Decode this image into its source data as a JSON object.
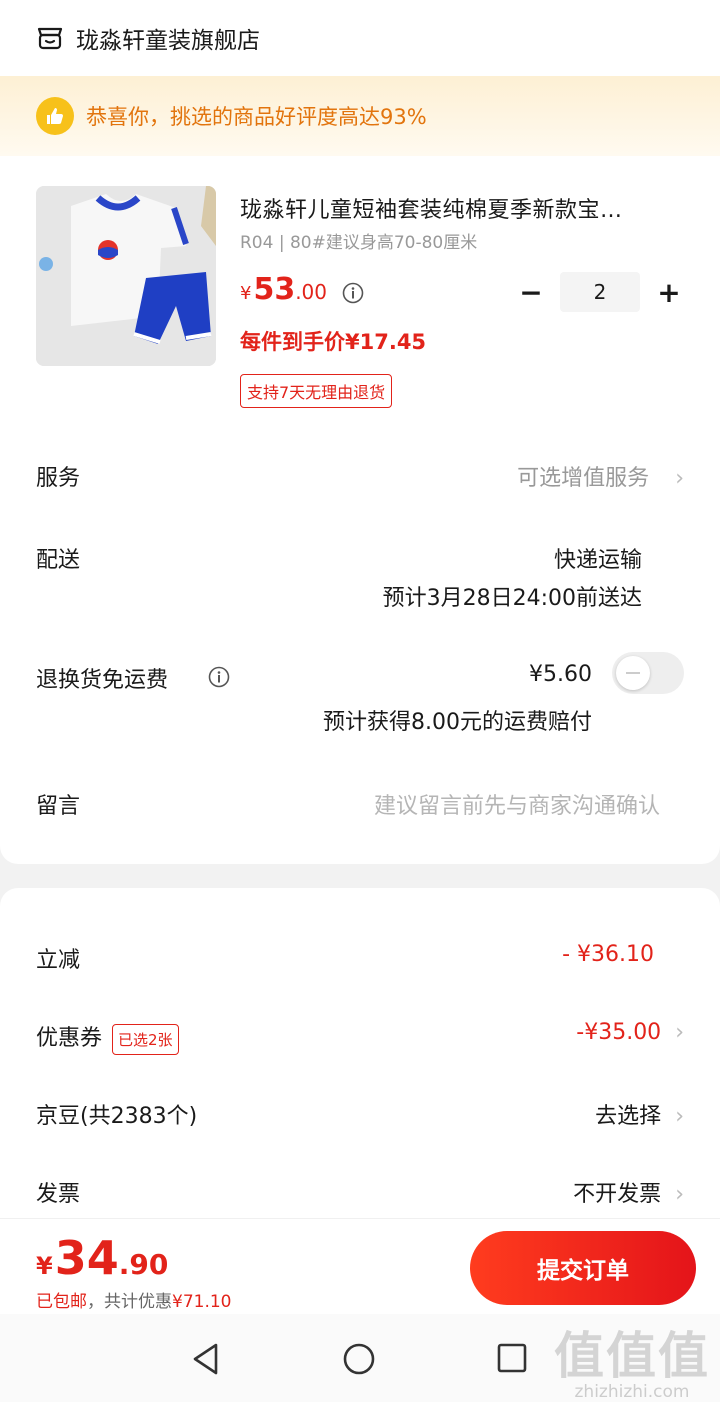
{
  "store": {
    "name": "珑淼轩童装旗舰店"
  },
  "banner": {
    "text": "恭喜你，挑选的商品好评度高达93%"
  },
  "product": {
    "title": "珑淼轩儿童短袖套装纯棉夏季新款宝…",
    "spec": "R04 | 80#建议身高70-80厘米",
    "price_currency": "¥",
    "price_int": "53",
    "price_dec": ".00",
    "unit_price": "每件到手价¥17.45",
    "return_tag": "支持7天无理由退货",
    "quantity": "2",
    "qty_minus": "−",
    "qty_plus": "+"
  },
  "service": {
    "label": "服务",
    "value": "可选增值服务"
  },
  "delivery": {
    "label": "配送",
    "method": "快递运输",
    "eta": "预计3月28日24:00前送达"
  },
  "return_insurance": {
    "label": "退换货免运费",
    "price": "¥5.60",
    "note": "预计获得8.00元的运费赔付",
    "enabled": false
  },
  "message": {
    "label": "留言",
    "placeholder": "建议留言前先与商家沟通确认"
  },
  "discount": {
    "label": "立减",
    "value": "- ¥36.10"
  },
  "coupon": {
    "label": "优惠券",
    "tag": "已选2张",
    "value": "-¥35.00"
  },
  "jingdou": {
    "label": "京豆(共2383个)",
    "value": "去选择"
  },
  "invoice": {
    "label": "发票",
    "value": "不开发票"
  },
  "total": {
    "currency": "¥",
    "int": "34",
    "dec": ".90",
    "shipping": "已包邮",
    "saving": "，共计优惠",
    "saving_amount": "¥71.10"
  },
  "submit": {
    "label": "提交订单"
  },
  "watermark": {
    "big": "值值值",
    "small": "zhizhizhi.com"
  },
  "colors": {
    "accent_red": "#e2231a",
    "banner_orange": "#e2740d",
    "badge_yellow": "#f7c11a"
  }
}
